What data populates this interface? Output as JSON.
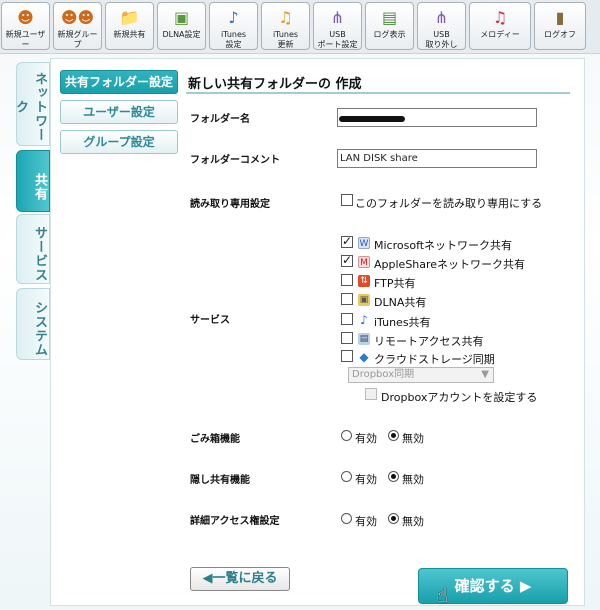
{
  "toolbar": {
    "buttons": [
      {
        "label": "新規ユーザー",
        "icon": "users-icon"
      },
      {
        "label": "新規グループ",
        "icon": "group-icon"
      },
      {
        "label": "新規共有",
        "icon": "folder-icon"
      },
      {
        "label": "DLNA設定",
        "icon": "dlna-icon"
      },
      {
        "label": "iTunes\n設定",
        "icon": "itunes-note-icon"
      },
      {
        "label": "iTunes\n更新",
        "icon": "itunes-refresh-icon"
      },
      {
        "label": "USB\nポート設定",
        "icon": "usb-icon"
      },
      {
        "label": "ログ表示",
        "icon": "log-icon"
      },
      {
        "label": "USB\n取り外し",
        "icon": "usb-eject-icon"
      },
      {
        "label": "メロディー",
        "icon": "melody-icon"
      },
      {
        "label": "ログオフ",
        "icon": "logoff-icon"
      }
    ]
  },
  "side_tabs": [
    "ネットワーク",
    "共有",
    "サービス",
    "システム"
  ],
  "menu": {
    "shared_folder": "共有フォルダー設定",
    "user": "ユーザー設定",
    "group": "グループ設定"
  },
  "form": {
    "title": "新しい共有フォルダーの 作成",
    "folder_name_label": "フォルダー名",
    "folder_comment_label": "フォルダーコメント",
    "folder_comment_value": "LAN DISK share",
    "readonly_label": "読み取り専用設定",
    "readonly_option": "このフォルダーを読み取り専用にする",
    "service_label": "サービス",
    "services": [
      {
        "label": "Microsoftネットワーク共有",
        "checked": true
      },
      {
        "label": "AppleShareネットワーク共有",
        "checked": true
      },
      {
        "label": "FTP共有",
        "checked": false
      },
      {
        "label": "DLNA共有",
        "checked": false
      },
      {
        "label": "iTunes共有",
        "checked": false
      },
      {
        "label": "リモートアクセス共有",
        "checked": false
      },
      {
        "label": "クラウドストレージ同期",
        "checked": false
      }
    ],
    "cloud_select": "Dropbox同期",
    "dropbox_account": "Dropboxアカウントを設定する",
    "trash_label": "ごみ箱機能",
    "hidden_label": "隠し共有機能",
    "access_label": "詳細アクセス権設定",
    "on": "有効",
    "off": "無効"
  },
  "buttons": {
    "back": "一覧に戻る",
    "confirm": "確認する"
  },
  "colors": {
    "accent": "#17a0ab",
    "accent_light": "#4fc5cf"
  }
}
